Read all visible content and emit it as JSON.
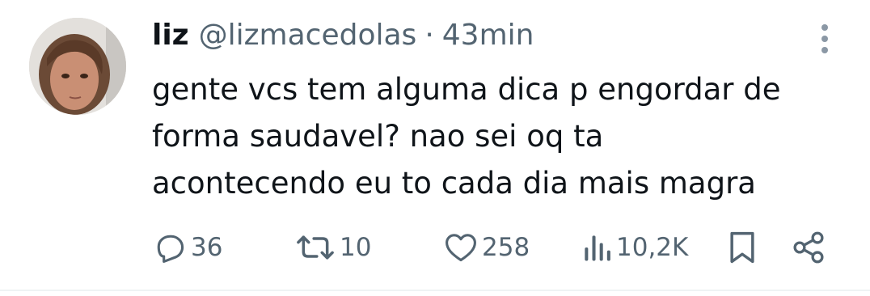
{
  "tweet": {
    "author": {
      "name": "liz",
      "handle": "@lizmacedolas",
      "avatar_icon": "user-avatar"
    },
    "separator": "·",
    "time": "43min",
    "text_lines": [
      "gente vcs tem alguma dica p engordar de",
      "forma saudavel? nao sei oq ta",
      "acontecendo eu to cada dia mais magra"
    ],
    "actions": {
      "replies": {
        "icon": "reply-icon",
        "count": "36"
      },
      "retweets": {
        "icon": "retweet-icon",
        "count": "10"
      },
      "likes": {
        "icon": "heart-icon",
        "count": "258"
      },
      "views": {
        "icon": "views-icon",
        "count": "10,2K"
      },
      "bookmark": {
        "icon": "bookmark-icon"
      },
      "share": {
        "icon": "share-icon"
      }
    },
    "more_icon": "more-vertical-icon"
  },
  "colors": {
    "primary_text": "#0f1419",
    "secondary_text": "#536471",
    "divider": "#eff3f4",
    "background": "#ffffff"
  }
}
